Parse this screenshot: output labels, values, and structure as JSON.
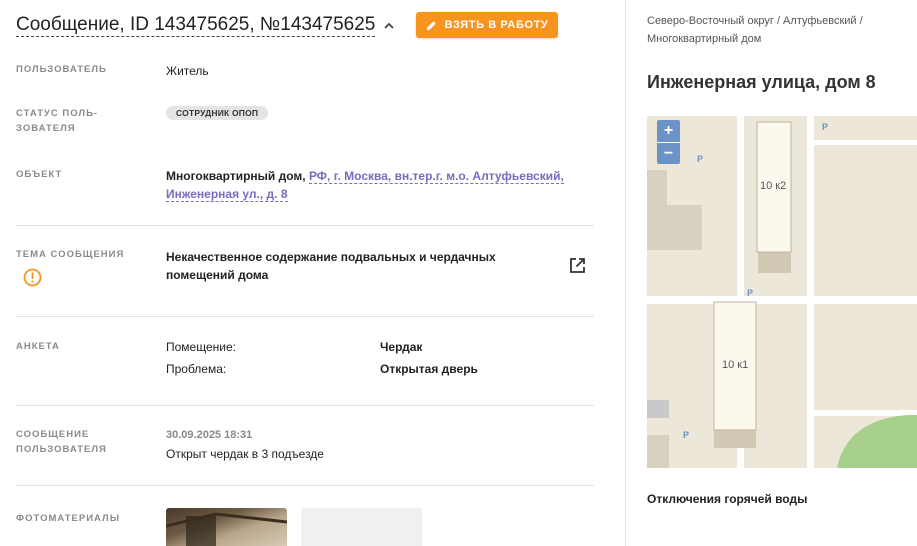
{
  "header": {
    "title": "Сообщение, ID 143475625, №143475625",
    "take_button": "ВЗЯТЬ В РАБОТУ"
  },
  "fields": {
    "user": {
      "label": "ПОЛЬЗОВАТЕЛЬ",
      "value": "Житель"
    },
    "user_status": {
      "label_1": "СТАТУС ПОЛЬ-",
      "label_2": "ЗОВАТЕЛЯ",
      "badge": "СОТРУДНИК ОПОП"
    },
    "object": {
      "label": "ОБЪЕКТ",
      "prefix": "Многоквартирный дом,",
      "link_1": "РФ, г. Москва, вн.тер.г. м.о. Алтуфьевский,",
      "link_2": "Инженерная ул., д. 8"
    },
    "topic": {
      "label": "ТЕМА СООБЩЕНИЯ",
      "value_1": "Некачественное содержание подвальных и чердачных",
      "value_2": "помещений дома"
    },
    "survey": {
      "label": "АНКЕТА",
      "rows": [
        {
          "key": "Помещение:",
          "value": "Чердак"
        },
        {
          "key": "Проблема:",
          "value": "Открытая дверь"
        }
      ]
    },
    "user_message": {
      "label_1": "СООБЩЕНИЕ",
      "label_2": "ПОЛЬЗОВАТЕЛЯ",
      "date": "30.09.2025 18:31",
      "text": "Открыт чердак в 3 подъезде"
    },
    "photos": {
      "label": "ФОТОМАТЕРИАЛЫ"
    }
  },
  "sidebar": {
    "breadcrumb_1": "Северо-Восточный округ / Алтуфьевский /",
    "breadcrumb_2": "Многоквартирный дом",
    "address": "Инженерная улица, дом 8",
    "map": {
      "zoom_in": "+",
      "zoom_out": "−",
      "building_1": "10 к2",
      "building_2": "10 к1",
      "parking": "P"
    },
    "outage": "Отключения горячей воды"
  },
  "colors": {
    "accent": "#f7941d",
    "link": "#7a6bbf",
    "map_zoom": "#6b93c7"
  }
}
